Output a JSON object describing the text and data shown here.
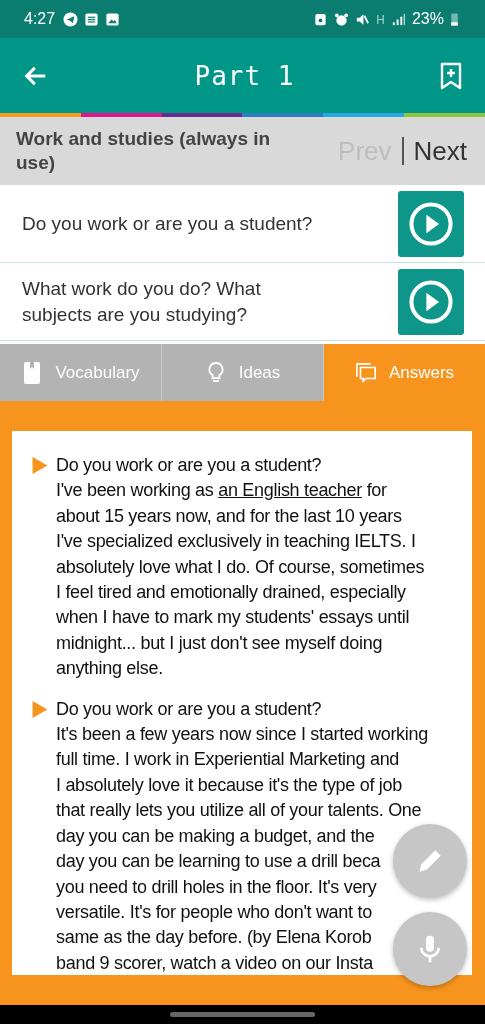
{
  "status_bar": {
    "time": "4:27",
    "battery": "23%"
  },
  "app_bar": {
    "title": "Part 1"
  },
  "topic": {
    "title": "Work and studies (always in use)",
    "prev": {
      "label": "Prev",
      "disabled": true
    },
    "next": {
      "label": "Next",
      "disabled": false
    }
  },
  "questions": [
    {
      "text": "Do you work or are you a student?"
    },
    {
      "text": "What work do you do? What subjects are you studying?"
    }
  ],
  "tabs": [
    {
      "label": "Vocabulary",
      "selected": false
    },
    {
      "label": "Ideas",
      "selected": false
    },
    {
      "label": "Answers",
      "selected": true
    }
  ],
  "answers": [
    {
      "question": "Do you work or are you a student?",
      "lines": [
        [
          {
            "text": "I've been working as ",
            "link": false
          },
          {
            "text": "an English teacher",
            "link": true
          },
          {
            "text": " for",
            "link": false
          }
        ],
        "about 15 years now, and for the last 10 years",
        "I've specialized exclusively in teaching IELTS. I",
        "absolutely love what I do. Of course, sometimes",
        "I feel tired and emotionally drained, especially",
        "when I have to mark my students' essays until",
        "midnight... but I just don't see myself doing",
        "anything else."
      ]
    },
    {
      "question": "Do you work or are you a student?",
      "lines": [
        "It's been a few years now since I started working",
        "full time. I work in Experiential Marketing and",
        "I absolutely love it because it's the type of job",
        "that really lets you utilize all of your talents. One",
        "day you can be making a budget, and the",
        "day you can be learning to use a drill beca",
        "you need to drill holes in the floor. It's very",
        "versatile. It's for people who don't want to",
        "same as the day before. (by Elena Korob",
        "band 9 scorer, watch a video on our Insta"
      ]
    }
  ]
}
